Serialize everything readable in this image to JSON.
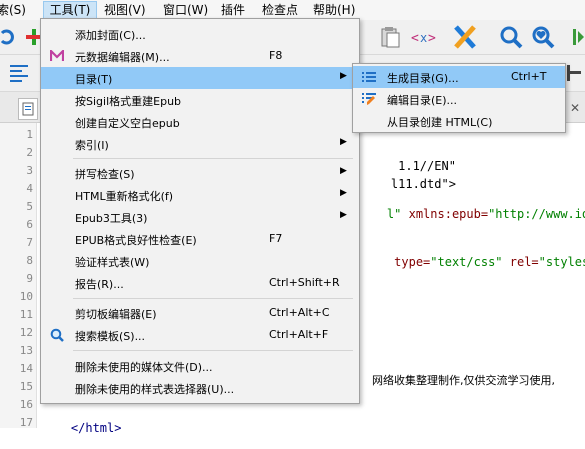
{
  "menubar": {
    "items": [
      "索(S)",
      "工具(T)",
      "视图(V)",
      "窗口(W)",
      "插件",
      "检查点",
      "帮助(H)"
    ]
  },
  "tools_menu": {
    "items": [
      {
        "label": "添加封面(C)...",
        "shortcut": "",
        "icon": "",
        "submenu": false
      },
      {
        "label": "元数据编辑器(M)...",
        "shortcut": "F8",
        "icon": "metadata-icon",
        "submenu": false
      },
      {
        "label": "目录(T)",
        "shortcut": "",
        "icon": "",
        "submenu": true
      },
      {
        "label": "按Sigil格式重建Epub",
        "shortcut": "",
        "icon": "",
        "submenu": false
      },
      {
        "label": "创建自定义空白epub",
        "shortcut": "",
        "icon": "",
        "submenu": false
      },
      {
        "label": "索引(I)",
        "shortcut": "",
        "icon": "",
        "submenu": true
      },
      {
        "label": "拼写检查(S)",
        "shortcut": "",
        "icon": "",
        "submenu": true
      },
      {
        "label": "HTML重新格式化(f)",
        "shortcut": "",
        "icon": "",
        "submenu": true
      },
      {
        "label": "Epub3工具(3)",
        "shortcut": "",
        "icon": "",
        "submenu": true
      },
      {
        "label": "EPUB格式良好性检查(E)",
        "shortcut": "F7",
        "icon": "",
        "submenu": false
      },
      {
        "label": "验证样式表(W)",
        "shortcut": "",
        "icon": "",
        "submenu": false
      },
      {
        "label": "报告(R)...",
        "shortcut": "Ctrl+Shift+R",
        "icon": "",
        "submenu": false
      },
      {
        "label": "剪切板编辑器(E)",
        "shortcut": "Ctrl+Alt+C",
        "icon": "",
        "submenu": false
      },
      {
        "label": "搜索模板(S)...",
        "shortcut": "Ctrl+Alt+F",
        "icon": "search-template-icon",
        "submenu": false
      },
      {
        "label": "删除未使用的媒体文件(D)...",
        "shortcut": "",
        "icon": "",
        "submenu": false
      },
      {
        "label": "删除未使用的样式表选择器(U)...",
        "shortcut": "",
        "icon": "",
        "submenu": false
      }
    ]
  },
  "toc_submenu": {
    "items": [
      {
        "label": "生成目录(G)...",
        "shortcut": "Ctrl+T",
        "icon": "generate-toc-icon"
      },
      {
        "label": "编辑目录(E)...",
        "shortcut": "",
        "icon": "edit-toc-icon"
      },
      {
        "label": "从目录创建 HTML(C)",
        "shortcut": "",
        "icon": ""
      }
    ]
  },
  "editor": {
    "line_numbers": [
      "1",
      "2",
      "3",
      "4",
      "5",
      "6",
      "7",
      "8",
      "9",
      "10",
      "11",
      "12",
      "13",
      "14",
      "15",
      "16",
      "17"
    ],
    "visible_lines": [
      {
        "parts": [
          {
            "t": " 1.1//EN\"",
            "c": "txt"
          }
        ]
      },
      {
        "parts": [
          {
            "t": "l11.dtd\">",
            "c": "txt"
          }
        ]
      },
      {
        "parts": [
          {
            "t": "l\" ",
            "c": "str"
          },
          {
            "t": "xmlns:epub=",
            "c": "attr"
          },
          {
            "t": "\"http://www.id",
            "c": "str"
          }
        ]
      },
      {
        "parts": [
          {
            "t": " ",
            "c": "txt"
          },
          {
            "t": "type=",
            "c": "attr"
          },
          {
            "t": "\"text/css\" ",
            "c": "str"
          },
          {
            "t": "rel=",
            "c": "attr"
          },
          {
            "t": "\"styles",
            "c": "str"
          }
        ]
      },
      {
        "parts": [
          {
            "t": "网络收集整理制作,仅供交流学习使用,",
            "c": "txt"
          }
        ]
      },
      {
        "parts": [
          {
            "t": "</html>",
            "c": "tag"
          }
        ]
      }
    ]
  },
  "colors": {
    "highlight": "#91c9f7",
    "menu_bg": "#f2f2f2",
    "tag": "#000080",
    "attr": "#800000",
    "string": "#008000"
  }
}
